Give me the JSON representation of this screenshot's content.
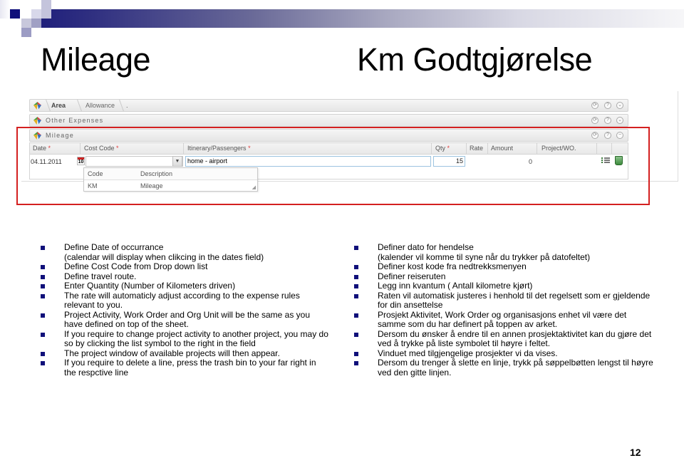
{
  "slide": {
    "title_left": "Mileage",
    "title_right": "Km Godtgjørelse",
    "page_number": "12",
    "accent_color": "#10107a",
    "highlight_color": "#d42020"
  },
  "app": {
    "breadcrumb": {
      "items": [
        "Area",
        "Allowance",
        "."
      ]
    },
    "panels": {
      "other_expenses": "Other Expenses",
      "mileage": "Mileage"
    },
    "panel_controls": [
      "refresh-icon",
      "help-icon",
      "collapse-icon"
    ],
    "grid": {
      "columns": [
        {
          "label": "Date",
          "required": true
        },
        {
          "label": "Cost Code",
          "required": true
        },
        {
          "label": "Itinerary/Passengers",
          "required": true
        },
        {
          "label": "Qty",
          "required": true
        },
        {
          "label": "Rate",
          "required": false
        },
        {
          "label": "Amount",
          "required": false
        },
        {
          "label": "Project/WO.",
          "required": false
        }
      ],
      "required_marker": "*",
      "row": {
        "date": "04.11.2011",
        "calendar_day": "10",
        "cost_code": "",
        "itinerary": "home - airport",
        "qty": "15",
        "rate": "",
        "amount": "0",
        "project_wo": ""
      }
    },
    "dropdown": {
      "headers": [
        "Code",
        "Description"
      ],
      "rows": [
        {
          "code": "KM",
          "description": "Mileage"
        }
      ]
    }
  },
  "instructions_en": [
    {
      "text": "Define Date of occurrance",
      "bullet": true
    },
    {
      "text": "(calendar will display when clikcing in the dates field)",
      "bullet": false
    },
    {
      "text": "Define Cost Code from Drop down list",
      "bullet": true
    },
    {
      "text": "Define travel route.",
      "bullet": true
    },
    {
      "text": "Enter Quantity (Number of Kilometers driven)",
      "bullet": true
    },
    {
      "text": "The rate will automaticly adjust according to the expense rules relevant to you.",
      "bullet": true
    },
    {
      "text": "Project Activity, Work Order and Org Unit will be the same as you have defined on top of the sheet.",
      "bullet": true
    },
    {
      "text": "If you require to change project activity to another project, you may do so by clicking the list symbol to the right in the field",
      "bullet": true
    },
    {
      "text": "The project window of available projects will then appear.",
      "bullet": true
    },
    {
      "text": "If you require to delete a line, press the trash bin to your far right in the respctive line",
      "bullet": true
    }
  ],
  "instructions_no": [
    {
      "text": "Definer dato for hendelse",
      "bullet": true
    },
    {
      "text": "(kalender vil komme til syne når du trykker på datofeltet)",
      "bullet": false
    },
    {
      "text": "Definer kost kode fra nedtrekksmenyen",
      "bullet": true
    },
    {
      "text": "Definer reiseruten",
      "bullet": true
    },
    {
      "text": "Legg inn kvantum ( Antall kilometre kjørt)",
      "bullet": true
    },
    {
      "text": "Raten vil automatisk justeres i henhold til det regelsett som er gjeldende for din ansettelse",
      "bullet": true
    },
    {
      "text": "Prosjekt Aktivitet, Work Order og organisasjons enhet vil være det samme som du har definert på toppen av arket.",
      "bullet": true
    },
    {
      "text": "Dersom du ønsker å endre til en annen prosjektaktivitet kan du gjøre det ved å trykke på liste symbolet til høyre i feltet.",
      "bullet": true
    },
    {
      "text": "Vinduet med tilgjengelige prosjekter vi da vises.",
      "bullet": true
    },
    {
      "text": "Dersom du trenger å slette en linje, trykk på søppelbøtten lengst til høyre ved den gitte linjen.",
      "bullet": true
    }
  ]
}
